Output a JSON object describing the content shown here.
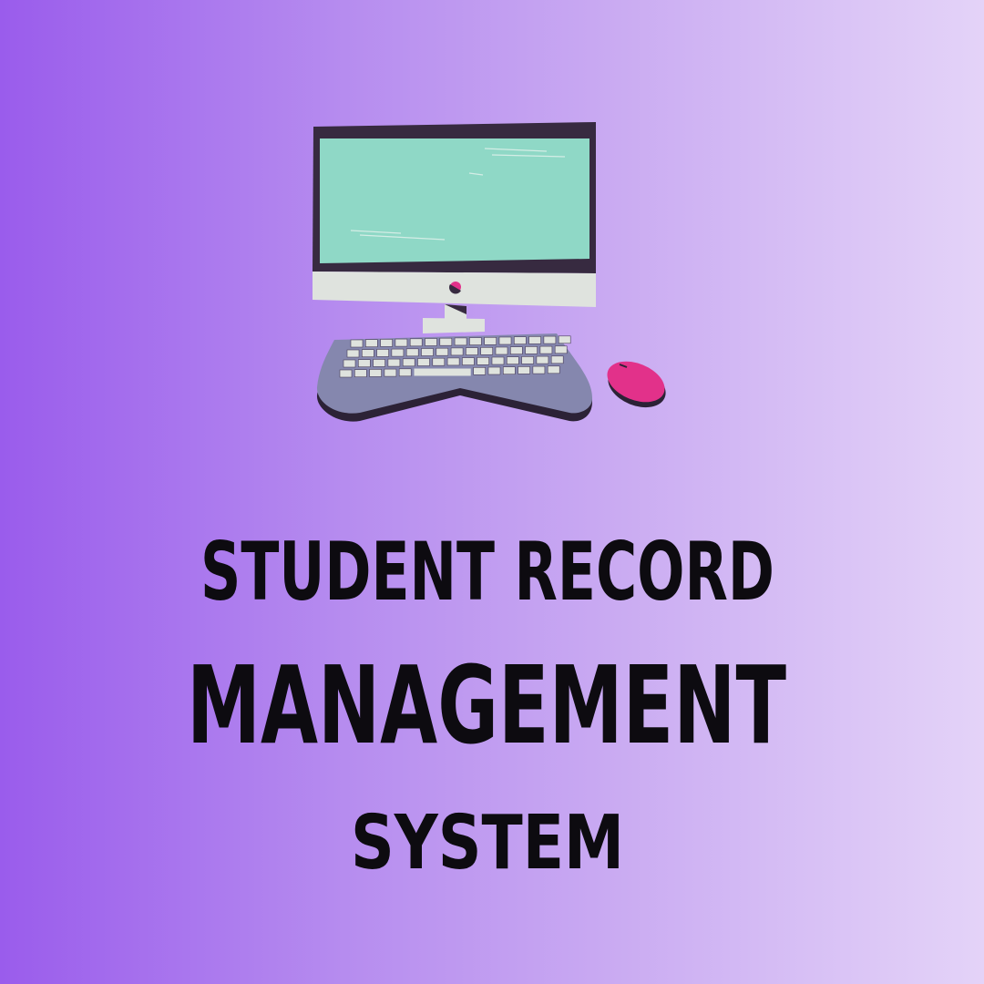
{
  "title": {
    "line1": "STUDENT RECORD",
    "line2": "MANAGEMENT",
    "line3": "SYSTEM"
  },
  "colors": {
    "background_start": "#9a5cec",
    "background_end": "#e4d3f8",
    "screen": "#8fd8c6",
    "bezel": "#372a40",
    "monitor_chin": "#dfe3de",
    "keyboard": "#8587ae",
    "mouse": "#e2318a",
    "text": "#0d0b10"
  },
  "icons": [
    "desktop-computer-icon",
    "keyboard-icon",
    "mouse-icon"
  ]
}
